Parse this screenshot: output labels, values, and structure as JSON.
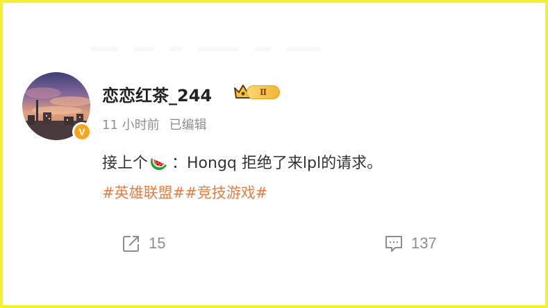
{
  "post": {
    "username": "恋恋红茶_244",
    "level_badge": "Ⅱ",
    "verified_mark": "V",
    "time": "11 小时前",
    "edited": "已编辑",
    "content_prefix": "接上个",
    "content_suffix": "：Hongq 拒绝了来lpl的请求。",
    "tags": [
      "#英雄联盟#",
      "#竞技游戏#"
    ],
    "share_count": "15",
    "comment_count": "137"
  },
  "icons": {
    "avatar": "avatar-image",
    "verified": "verified-badge-icon",
    "crown": "crown-icon",
    "emoji": "watermelon-emoji-icon",
    "share": "share-icon",
    "comment": "comment-icon"
  },
  "colors": {
    "frame": "#f5f02e",
    "tag": "#f07a3c",
    "badge": "#f7a51a",
    "meta": "#8f8f8f",
    "text": "#333333"
  }
}
